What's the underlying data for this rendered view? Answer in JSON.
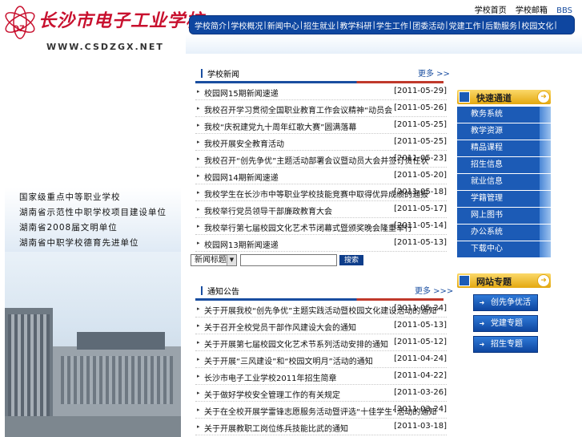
{
  "header": {
    "school_name": "长沙市电子工业学校",
    "logo_emblem_text": "DZ",
    "website": "WWW.CSDZGX.NET",
    "top_links": [
      "学校首页",
      "学校邮箱",
      "BBS"
    ],
    "nav": [
      "学校简介",
      "学校概况",
      "新闻中心",
      "招生就业",
      "教学科研",
      "学生工作",
      "团委活动",
      "党建工作",
      "后勤服务",
      "校园文化"
    ]
  },
  "banner": {
    "honors": [
      "国家级重点中等职业学校",
      "湖南省示范性中职学校项目建设单位",
      "湖南省2008届文明单位",
      "湖南省中职学校德育先进单位"
    ]
  },
  "news": {
    "title": "学校新闻",
    "more": "更多 >>",
    "items": [
      {
        "title": "校园网15期新闻速递",
        "date": "[2011-05-29]"
      },
      {
        "title": "我校召开学习贯彻全国职业教育工作会议精神“动员会",
        "date": "[2011-05-26]"
      },
      {
        "title": "我校“庆祝建党九十周年红歌大赛”圆满落幕",
        "date": "[2011-05-25]"
      },
      {
        "title": "我校开展安全教育活动",
        "date": "[2011-05-25]"
      },
      {
        "title": "我校召开“创先争优”主题活动部署会议暨动员大会并签订责任状",
        "date": "[2011-05-23]"
      },
      {
        "title": "校园网14期新闻速递",
        "date": "[2011-05-20]"
      },
      {
        "title": "我校学生在长沙市中等职业学校技能竞赛中取得优异成绩的通报",
        "date": "[2011-05-18]"
      },
      {
        "title": "我校举行党员领导干部廉政教育大会",
        "date": "[2011-05-17]"
      },
      {
        "title": "我校举行第七届校园文化艺术节闭幕式暨颁奖晚会隆重举行",
        "date": "[2011-05-14]"
      },
      {
        "title": "校园网13期新闻速递",
        "date": "[2011-05-13]"
      }
    ]
  },
  "search": {
    "scope": "新闻标题",
    "input_value": "",
    "button_label": "搜索"
  },
  "notices": {
    "title": "通知公告",
    "more": "更多 >>>",
    "items": [
      {
        "title": "关于开展我校“创先争优”主题实践活动暨校园文化建设活动的通知”",
        "date": "[2011-05-24]"
      },
      {
        "title": "关于召开全校党员干部作风建设大会的通知",
        "date": "[2011-05-13]"
      },
      {
        "title": "关于开展第七届校园文化艺术节系列活动安排的通知",
        "date": "[2011-05-12]"
      },
      {
        "title": "关于开展“三风建设”和“校园文明月”活动的通知",
        "date": "[2011-04-24]"
      },
      {
        "title": "长沙市电子工业学校2011年招生简章",
        "date": "[2011-04-22]"
      },
      {
        "title": "关于做好学校安全管理工作的有关规定",
        "date": "[2011-03-26]"
      },
      {
        "title": "关于在全校开展学雷锋志愿服务活动暨评选“十佳学生”活动的通知",
        "date": "[2011-03-24]"
      },
      {
        "title": "关于开展教职工岗位练兵技能比武的通知",
        "date": "[2011-03-18]"
      }
    ]
  },
  "quick": {
    "title": "快速通道",
    "items": [
      "教务系统",
      "教学资源",
      "精品课程",
      "招生信息",
      "就业信息",
      "学籍管理",
      "网上图书",
      "办公系统",
      "下载中心"
    ]
  },
  "topics": {
    "title": "网站专题",
    "items": [
      "创先争优活动",
      "党建专题",
      "招生专题"
    ]
  },
  "colors": {
    "nav_blue": "#0e46a0",
    "logo_red": "#c8102e",
    "tab_gold": "#e3a810",
    "link_blue": "#1a4ea0"
  }
}
